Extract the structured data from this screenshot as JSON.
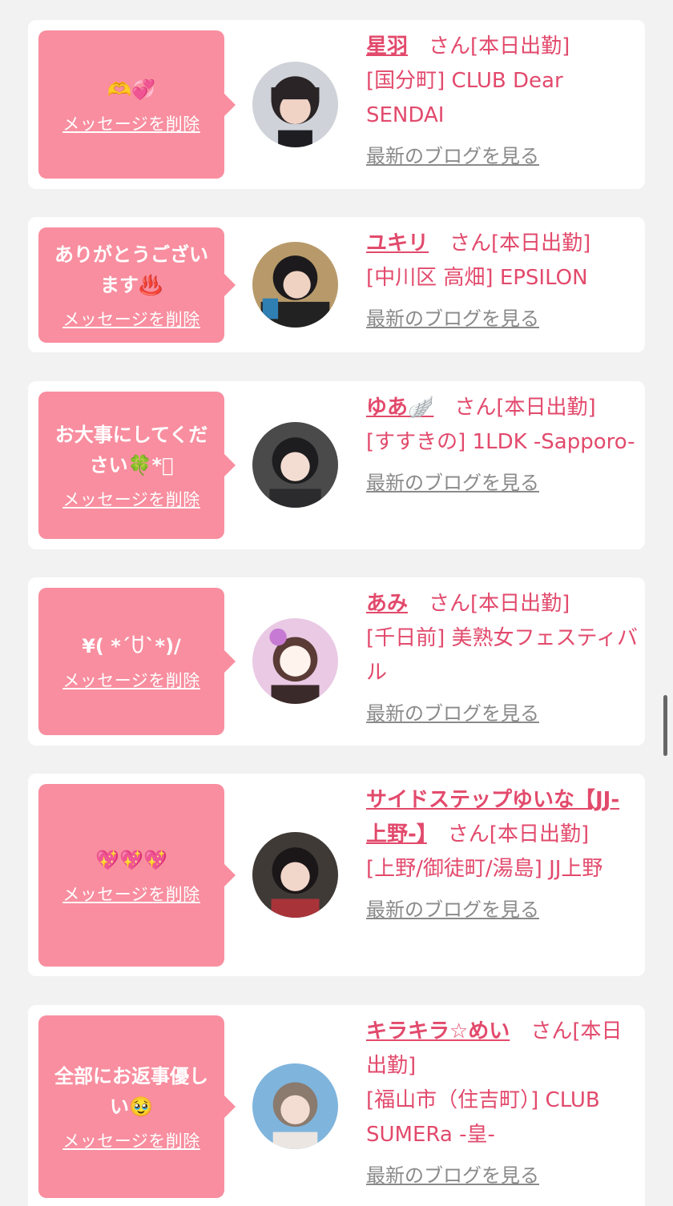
{
  "cards": [
    {
      "message": "🫶💞",
      "delete_label": "メッセージを削除",
      "name": "星羽",
      "suffix": "　さん[本日出勤]",
      "shop": "[国分町] CLUB Dear SENDAI",
      "blog_label": "最新のブログを見る"
    },
    {
      "message": "ありがとうございます♨️",
      "delete_label": "メッセージを削除",
      "name": "ユキリ",
      "suffix": "　さん[本日出勤]",
      "shop": "[中川区 高畑] EPSILON",
      "blog_label": "最新のブログを見る"
    },
    {
      "message": "お大事にしてください🍀*ﾟ",
      "delete_label": "メッセージを削除",
      "name": "ゆあ🪽",
      "suffix": "　さん[本日出勤]",
      "shop": "[すすきの] 1LDK -Sapporo-",
      "blog_label": "最新のブログを見る"
    },
    {
      "message": "¥( *´ꇴ`*)/",
      "delete_label": "メッセージを削除",
      "name": "あみ",
      "suffix": "　さん[本日出勤]",
      "shop": "[千日前] 美熟女フェスティバル",
      "blog_label": "最新のブログを見る"
    },
    {
      "message": "💖💖💖",
      "delete_label": "メッセージを削除",
      "name": "サイドステップゆいな【JJ-上野-】",
      "suffix": "　さん[本日出勤]",
      "shop": "[上野/御徒町/湯島] JJ上野",
      "blog_label": "最新のブログを見る"
    },
    {
      "message": "全部にお返事優しい🥹",
      "delete_label": "メッセージを削除",
      "name": "キラキラ☆めい",
      "suffix": "　さん[本日出勤]",
      "shop": "[福山市（住吉町）] CLUB SUMERa -皇-",
      "blog_label": "最新のブログを見る"
    }
  ],
  "colors": {
    "accent": "#e24a6c",
    "bubble": "#f88e9f",
    "page_bg": "#f2f2f2",
    "link_gray": "#8a8a8a"
  }
}
